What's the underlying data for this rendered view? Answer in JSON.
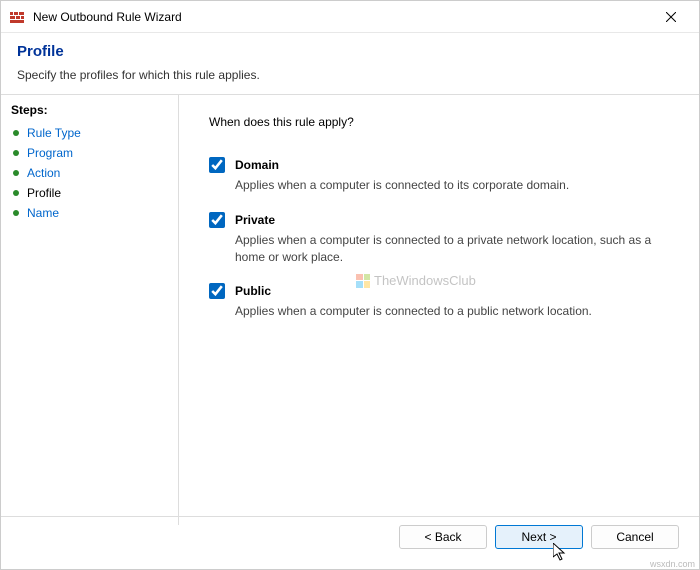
{
  "window": {
    "title": "New Outbound Rule Wizard"
  },
  "header": {
    "title": "Profile",
    "subtitle": "Specify the profiles for which this rule applies."
  },
  "sidebar": {
    "heading": "Steps:",
    "items": [
      {
        "label": "Rule Type",
        "current": false
      },
      {
        "label": "Program",
        "current": false
      },
      {
        "label": "Action",
        "current": false
      },
      {
        "label": "Profile",
        "current": true
      },
      {
        "label": "Name",
        "current": false
      }
    ]
  },
  "content": {
    "question": "When does this rule apply?",
    "options": [
      {
        "label": "Domain",
        "checked": true,
        "desc": "Applies when a computer is connected to its corporate domain."
      },
      {
        "label": "Private",
        "checked": true,
        "desc": "Applies when a computer is connected to a private network location, such as a home or work place."
      },
      {
        "label": "Public",
        "checked": true,
        "desc": "Applies when a computer is connected to a public network location."
      }
    ]
  },
  "watermark": {
    "text": "TheWindowsClub"
  },
  "footer": {
    "back": "< Back",
    "next": "Next >",
    "cancel": "Cancel"
  },
  "attribution": "wsxdn.com"
}
